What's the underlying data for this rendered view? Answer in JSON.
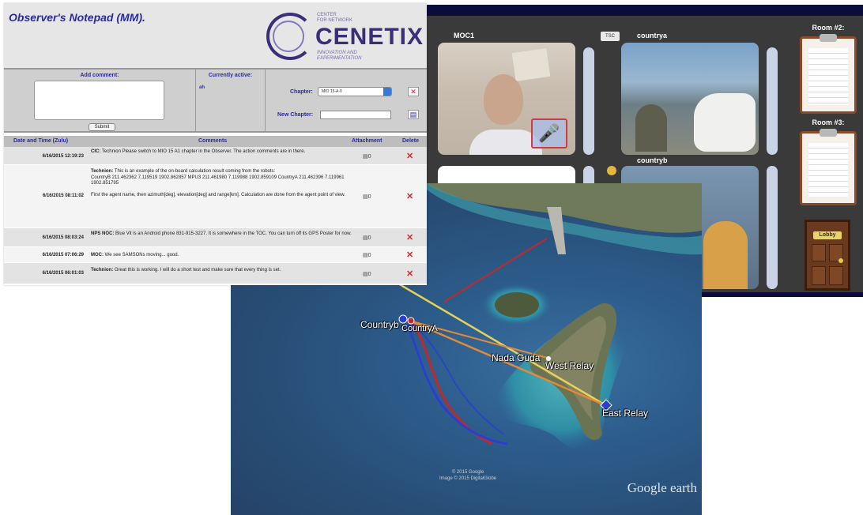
{
  "notepad": {
    "title": "Observer's Notepad (MM).",
    "logo": {
      "name": "CENETIX",
      "sub_top": "CENTER\nFOR NETWORK",
      "sub_bottom": "INNOVATION AND\nEXPERIMENTATION"
    },
    "form": {
      "add_comment_label": "Add comment:",
      "submit_label": "Submit",
      "currently_active_label": "Currently active:",
      "currently_active_value": "ah",
      "chapter_label": "Chapter:",
      "chapter_value": "MIO 15-A-0",
      "new_chapter_label": "New Chapter:"
    },
    "table": {
      "headers": {
        "date": "Date and Time (Zulu)",
        "comments": "Comments",
        "attachment": "Attachment",
        "delete": "Delete"
      },
      "rows": [
        {
          "date": "6/16/2015 12:19:23",
          "author": "CIC:",
          "text": "Technion Please switch to MIO 15 A1 chapter in the Observer. The action comments are in there.",
          "attachment": "0"
        },
        {
          "date": "6/16/2015 08:11:02",
          "author": "Technion:",
          "text": "This is an example of the on-board calculation result coming from the robots:\nCountryB 211.462362 7.119519 1902.862857 MPU3 211.461980 7.119988 1902.859109 CountryA 211.462396 7.119961 1902.851795\n\nFirst the agent name, then azimuth[deg], elevation[deg] and range[km]. Calculation are done from the agent point of view.",
          "attachment": "0"
        },
        {
          "date": "6/16/2015 08:03:24",
          "author": "NPS NOC:",
          "text": "Blue Vit is an Android phone 831-915-3227. It is somewhere in the TOC. You can turn off its GPS Poster for now.",
          "attachment": "0"
        },
        {
          "date": "6/16/2015 07:06:29",
          "author": "MOC:",
          "text": "We see SAMSONs moving... good.",
          "attachment": "0"
        },
        {
          "date": "6/16/2015 06:01:03",
          "author": "Technion:",
          "text": "Great this is working. I will do a short test and make sure that every thing is set.",
          "attachment": "0"
        }
      ],
      "delete_symbol": "✕",
      "attachment_symbol": "▤"
    }
  },
  "video": {
    "tiles": {
      "moc1": "MOC1",
      "countrya": "countrya",
      "countryb": "countryb"
    },
    "rooms": {
      "room2": "Room #2:",
      "room3": "Room #3:",
      "lobby": "Lobby"
    },
    "badge": "TSC"
  },
  "map": {
    "labels": {
      "countryb": "Countryb",
      "countrya": "CountryA",
      "nada_guda": "Nada Guda",
      "west_relay": "West Relay",
      "east_relay": "East Relay"
    },
    "watermark": "Google earth",
    "copyright": "© 2015 Google\nImage © 2015 DigitalGlobe"
  },
  "colors": {
    "title_blue": "#2a2aa0",
    "delete_red": "#e0262b",
    "track_red": "#c0282b",
    "track_blue": "#2a3fd0",
    "link_yellow": "#e6d25a",
    "link_orange": "#e08a3a"
  }
}
